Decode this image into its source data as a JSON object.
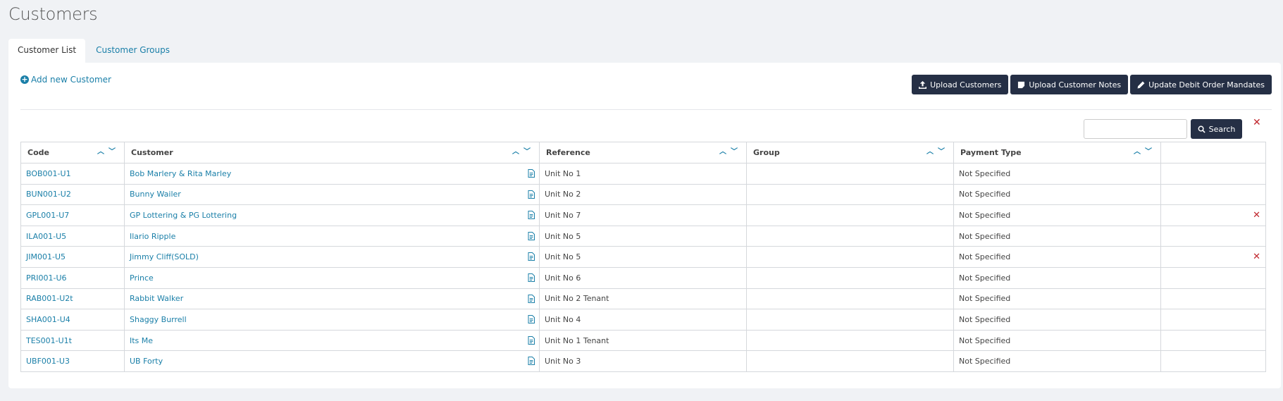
{
  "page": {
    "title": "Customers"
  },
  "tabs": [
    {
      "label": "Customer List",
      "active": true
    },
    {
      "label": "Customer Groups",
      "active": false
    }
  ],
  "toolbar": {
    "add_label": "Add new Customer",
    "upload_customers": "Upload Customers",
    "upload_notes": "Upload Customer Notes",
    "update_mandates": "Update Debit Order Mandates"
  },
  "search": {
    "value": "",
    "placeholder": "",
    "button_label": "Search",
    "clear_icon": "close-icon"
  },
  "table": {
    "columns": [
      "Code",
      "Customer",
      "Reference",
      "Group",
      "Payment Type",
      ""
    ],
    "rows": [
      {
        "code": "BOB001-U1",
        "customer": "Bob Marlery & Rita Marley",
        "reference": "Unit No 1",
        "group": "",
        "payment_type": "Not Specified",
        "deletable": false
      },
      {
        "code": "BUN001-U2",
        "customer": "Bunny Wailer",
        "reference": "Unit No 2",
        "group": "",
        "payment_type": "Not Specified",
        "deletable": false
      },
      {
        "code": "GPL001-U7",
        "customer": "GP Lottering & PG Lottering",
        "reference": "Unit No 7",
        "group": "",
        "payment_type": "Not Specified",
        "deletable": true
      },
      {
        "code": "ILA001-U5",
        "customer": "Ilario Ripple",
        "reference": "Unit No 5",
        "group": "",
        "payment_type": "Not Specified",
        "deletable": false
      },
      {
        "code": "JIM001-U5",
        "customer": "Jimmy Cliff(SOLD)",
        "reference": "Unit No 5",
        "group": "",
        "payment_type": "Not Specified",
        "deletable": true
      },
      {
        "code": "PRI001-U6",
        "customer": "Prince",
        "reference": "Unit No 6",
        "group": "",
        "payment_type": "Not Specified",
        "deletable": false
      },
      {
        "code": "RAB001-U2t",
        "customer": "Rabbit Walker",
        "reference": "Unit No 2 Tenant",
        "group": "",
        "payment_type": "Not Specified",
        "deletable": false
      },
      {
        "code": "SHA001-U4",
        "customer": "Shaggy Burrell",
        "reference": "Unit No 4",
        "group": "",
        "payment_type": "Not Specified",
        "deletable": false
      },
      {
        "code": "TES001-U1t",
        "customer": "Its Me",
        "reference": "Unit No 1 Tenant",
        "group": "",
        "payment_type": "Not Specified",
        "deletable": false
      },
      {
        "code": "UBF001-U3",
        "customer": "UB Forty",
        "reference": "Unit No 3",
        "group": "",
        "payment_type": "Not Specified",
        "deletable": false
      }
    ]
  },
  "colors": {
    "accent": "#1a7fa8",
    "button_bg": "#252f45",
    "danger": "#c0262d",
    "page_bg": "#f0f2f5"
  }
}
